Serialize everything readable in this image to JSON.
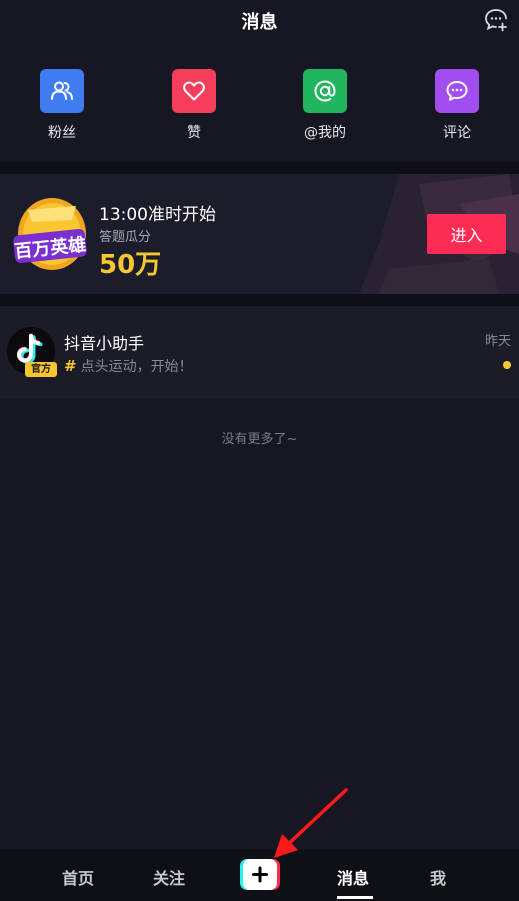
{
  "header": {
    "title": "消息"
  },
  "quick_actions": [
    {
      "label": "粉丝",
      "icon": "fans-icon",
      "color": "#3f7bf1"
    },
    {
      "label": "赞",
      "icon": "heart-icon",
      "color": "#f53e5c"
    },
    {
      "label": "@我的",
      "icon": "at-icon",
      "color": "#21b65e"
    },
    {
      "label": "评论",
      "icon": "comment-icon",
      "color": "#a24df0"
    }
  ],
  "banner": {
    "logo_text": "百万英雄",
    "time_text": "13:00准时开始",
    "subtitle": "答题瓜分",
    "prize": "50万",
    "enter_label": "进入"
  },
  "messages": [
    {
      "name": "抖音小助手",
      "badge": "官方",
      "preview": "点头运动，开始！",
      "time": "昨天",
      "unread": true
    }
  ],
  "list_end_text": "没有更多了~",
  "bottom_nav": {
    "home": "首页",
    "follow": "关注",
    "messages": "消息",
    "me": "我",
    "active": "messages"
  },
  "colors": {
    "background": "#161722",
    "accent_red": "#fd2c55",
    "gold": "#f8c630"
  }
}
